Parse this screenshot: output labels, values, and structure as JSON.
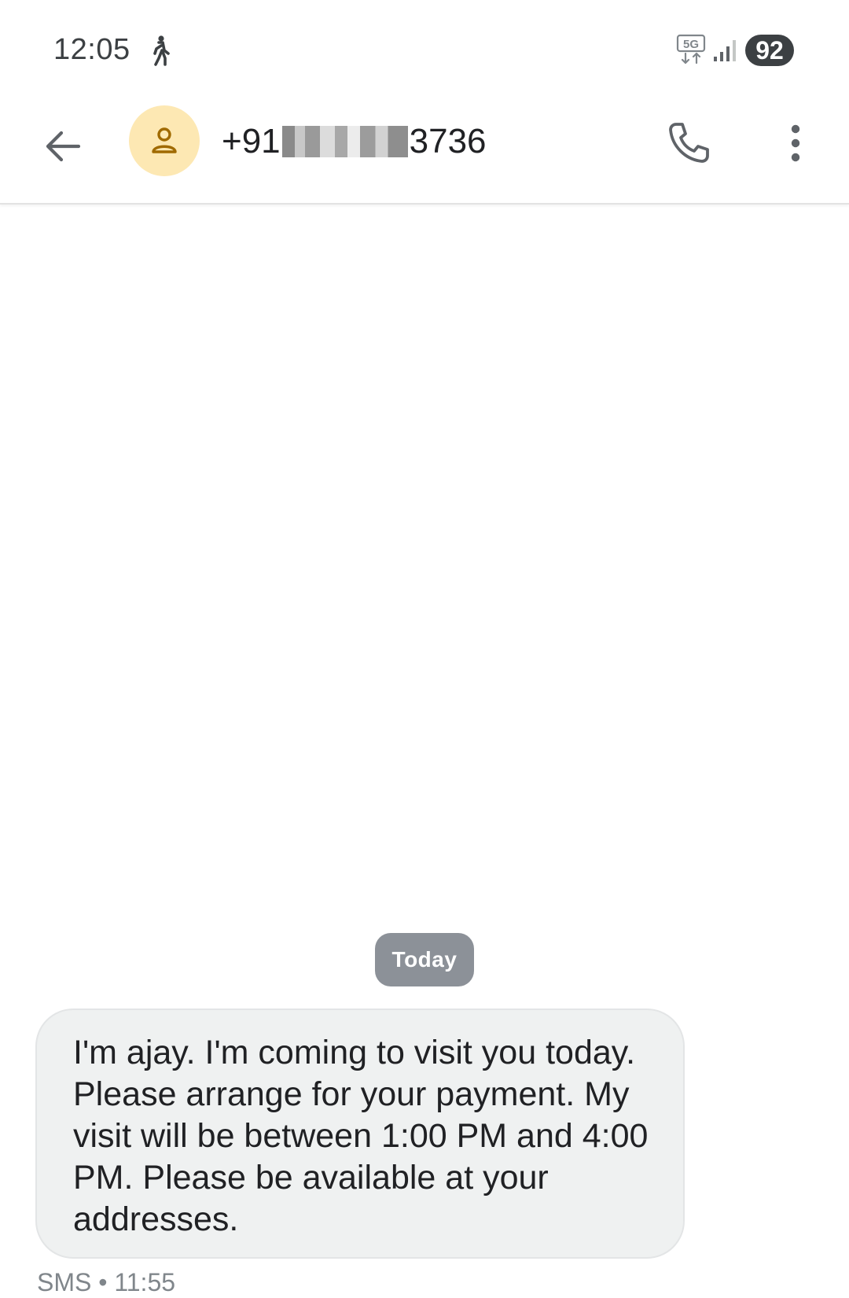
{
  "status_bar": {
    "time": "12:05",
    "network": "5G",
    "battery": "92"
  },
  "header": {
    "number_prefix": "+91",
    "number_suffix": "3736"
  },
  "conversation": {
    "date_divider": "Today",
    "message": {
      "text": "I'm ajay. I'm coming to visit you today. Please arrange for your payment. My visit will be between 1:00 PM and 4:00 PM. Please be available at your addresses.",
      "type": "SMS",
      "separator": "•",
      "time": "11:55"
    }
  },
  "colors": {
    "avatar_bg": "#fde8b3",
    "avatar_icon": "#a06a00",
    "bubble_bg": "#eff1f1",
    "date_chip_bg": "#8c9198",
    "icon_gray": "#5f6368"
  },
  "icons": {
    "back": "arrow-left",
    "avatar": "person",
    "call": "phone",
    "more": "three-dots-vertical",
    "activity": "walking-person",
    "signal": "cell-signal-bars"
  }
}
